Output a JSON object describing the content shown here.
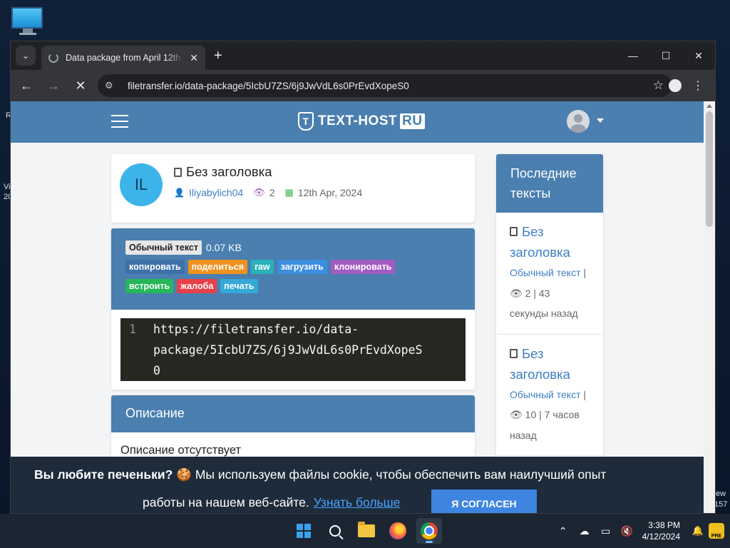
{
  "desktop": {
    "left_text_1": "R",
    "left_text_2": "Vi",
    "left_text_3": "20",
    "right_text_1": "ew",
    "right_text_2": "157"
  },
  "browser": {
    "tab_title": "Data package from April 12th.",
    "url": "filetransfer.io/data-package/5IcbU7ZS/6j9JwVdL6s0PrEvdXopeS0"
  },
  "site": {
    "logo_text": "TEXT-HOST",
    "logo_ru": "RU",
    "logo_mark": "T"
  },
  "paste": {
    "avatar_initials": "IL",
    "title": "Без заголовка",
    "author": "Iliyabylich04",
    "views": "2",
    "date": "12th Apr, 2024",
    "syntax": "Обычный текст",
    "size": "0.07 KB",
    "actions": {
      "copy": "копировать",
      "share": "поделиться",
      "raw": "raw",
      "download": "загрузить",
      "clone": "клонировать",
      "embed": "встроить",
      "report": "жалоба",
      "print": "печать"
    },
    "line_number": "1",
    "code_line_1": "https://filetransfer.io/data-",
    "code_line_2": "package/5IcbU7ZS/6j9JwVdL6s0PrEvdXopeS",
    "code_line_3": "0"
  },
  "description": {
    "heading": "Описание",
    "body": "Описание отсутствует"
  },
  "sidebar": {
    "heading": "Последние тексты",
    "items": [
      {
        "title": "Без заголовка",
        "type": "Обычный текст",
        "sep1": " | ",
        "views": "2",
        "sep2": " | ",
        "age": "43 секунды назад"
      },
      {
        "title": "Без заголовка",
        "type": "Обычный текст",
        "sep1": " | ",
        "views": "10",
        "sep2": " | ",
        "age": "7 часов назад"
      }
    ]
  },
  "cookie": {
    "question": "Вы любите печеньки?",
    "emoji": "🍪",
    "text_1": "Мы используем файлы cookie, чтобы обеспечить вам наилучший опыт",
    "text_2": "работы на нашем веб-сайте.",
    "learn_more": "Узнать больше",
    "agree": "Я СОГЛАСЕН"
  },
  "taskbar": {
    "time": "3:38 PM",
    "date": "4/12/2024",
    "pre_badge": "PRE"
  },
  "colors": {
    "brand": "#4a7fb0",
    "link": "#3d7fc6",
    "avatar": "#3cb4ea"
  }
}
